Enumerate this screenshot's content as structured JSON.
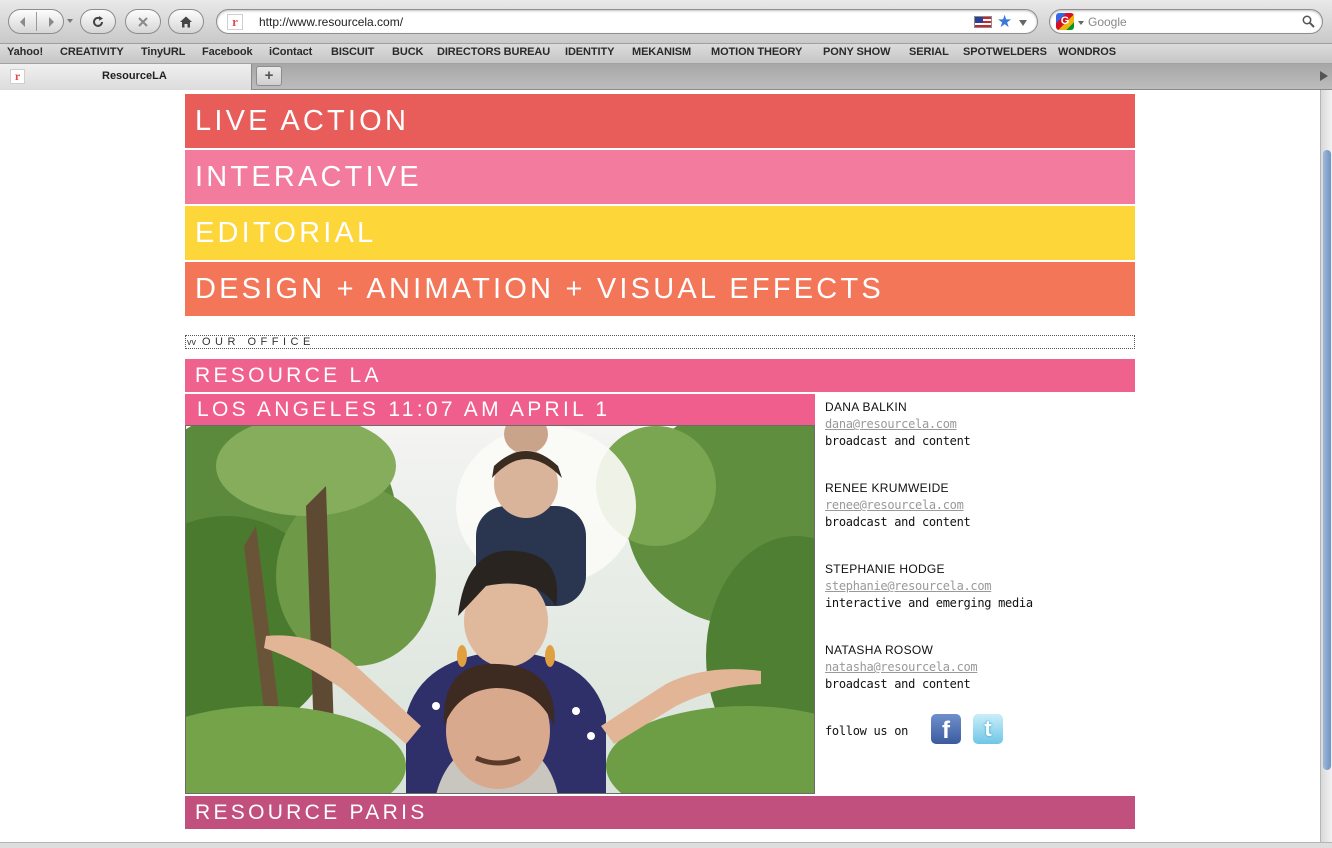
{
  "browser": {
    "url": "http://www.resourcela.com/",
    "search_placeholder": "Google",
    "tab_title": "ResourceLA",
    "new_tab_label": "+",
    "favicon_letter": "r"
  },
  "bookmarks": [
    "Yahoo!",
    "CREATIVITY",
    "TinyURL",
    "Facebook",
    "iContact",
    "BISCUIT",
    "BUCK",
    "DIRECTORS BUREAU",
    "IDENTITY",
    "MEKANISM",
    "MOTION THEORY",
    "PONY SHOW",
    "SERIAL",
    "SPOTWELDERS",
    "WONDROS"
  ],
  "categories": [
    {
      "label": "LIVE ACTION",
      "color": "#e85c5a"
    },
    {
      "label": "INTERACTIVE",
      "color": "#f27b9e"
    },
    {
      "label": "EDITORIAL",
      "color": "#fdd63a"
    },
    {
      "label": "DESIGN + ANIMATION + VISUAL EFFECTS",
      "color": "#f47658"
    }
  ],
  "office_toggle": {
    "arrows": "vv",
    "label": "OUR OFFICE"
  },
  "office": {
    "name": "RESOURCE LA",
    "name_color": "#f0628e",
    "time_label": "LOS ANGELES 11:07 AM APRIL 1"
  },
  "contacts": [
    {
      "name": "DANA BALKIN",
      "email": "dana@resourcela.com",
      "role": "broadcast and content"
    },
    {
      "name": "RENEE KRUMWEIDE",
      "email": "renee@resourcela.com",
      "role": "broadcast and content"
    },
    {
      "name": "STEPHANIE HODGE",
      "email": "stephanie@resourcela.com",
      "role": "interactive and emerging media"
    },
    {
      "name": "NATASHA ROSOW",
      "email": "natasha@resourcela.com",
      "role": "broadcast and content"
    }
  ],
  "follow": {
    "label": "follow us on",
    "facebook_glyph": "f",
    "twitter_glyph": "t"
  },
  "next_office": {
    "name": "RESOURCE PARIS",
    "color": "#c1507f"
  }
}
